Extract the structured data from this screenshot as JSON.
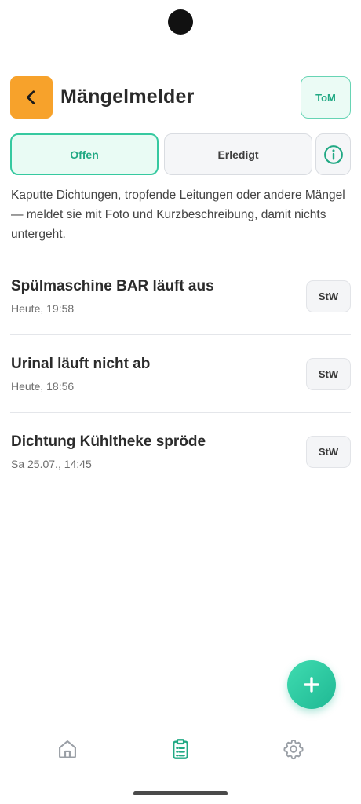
{
  "header": {
    "title": "Mängelmelder",
    "user_initials": "ToM"
  },
  "tabs": [
    {
      "label": "Offen",
      "active": true
    },
    {
      "label": "Erledigt",
      "active": false
    }
  ],
  "description": "Kaputte Dichtungen, tropfende Leitungen oder andere Mängel — meldet sie mit Foto und Kurzbeschreibung, damit nichts untergeht.",
  "reports": [
    {
      "title": "Spülmaschine BAR läuft aus",
      "time": "Heute, 19:58",
      "author": "StW"
    },
    {
      "title": "Urinal läuft nicht ab",
      "time": "Heute, 18:56",
      "author": "StW"
    },
    {
      "title": "Dichtung Kühltheke spröde",
      "time": "Sa 25.07., 14:45",
      "author": "StW"
    }
  ],
  "icons": {
    "back": "chevron-left-icon",
    "info": "info-icon",
    "add": "plus-icon",
    "nav": [
      "home-icon",
      "clipboard-list-icon",
      "gear-icon"
    ]
  },
  "colors": {
    "accent": "#21a984",
    "back_button": "#f7a22b"
  }
}
